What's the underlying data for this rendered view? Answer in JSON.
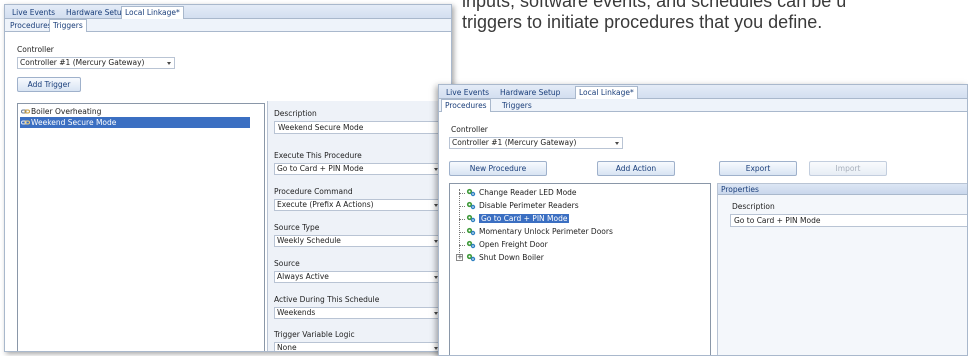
{
  "caption": {
    "line1": "inputs, software events, and schedules can be u",
    "line2": "triggers to initiate procedures that you define."
  },
  "window1": {
    "main_tabs": [
      "Live Events",
      "Hardware Setup",
      "Local Linkage*"
    ],
    "sub_tabs": [
      "Procedures",
      "Triggers"
    ],
    "controller_label": "Controller",
    "controller_value": "Controller #1 (Mercury Gateway)",
    "add_trigger_label": "Add Trigger",
    "triggers": [
      "Boiler Overheating",
      "Weekend Secure Mode"
    ],
    "selected_trigger": 1,
    "properties": [
      {
        "label": "Description",
        "value": "Weekend Secure Mode",
        "type": "text"
      },
      {
        "label": "Execute This Procedure",
        "value": "Go to Card + PIN Mode",
        "type": "combo"
      },
      {
        "label": "Procedure Command",
        "value": "Execute (Prefix A Actions)",
        "type": "combo"
      },
      {
        "label": "Source Type",
        "value": "Weekly Schedule",
        "type": "combo"
      },
      {
        "label": "Source",
        "value": "Always Active",
        "type": "combo"
      },
      {
        "label": "Active During This Schedule",
        "value": "Weekends",
        "type": "combo"
      },
      {
        "label": "Trigger Variable Logic",
        "value": "None",
        "type": "combo"
      }
    ]
  },
  "window2": {
    "main_tabs": [
      "Live Events",
      "Hardware Setup",
      "Local Linkage*"
    ],
    "sub_tabs": [
      "Procedures",
      "Triggers"
    ],
    "controller_label": "Controller",
    "controller_value": "Controller #1 (Mercury Gateway)",
    "new_procedure_label": "New Procedure",
    "add_action_label": "Add Action",
    "export_label": "Export",
    "import_label": "Import",
    "procedures": [
      "Change Reader LED Mode",
      "Disable Perimeter Readers",
      "Go to Card + PIN Mode",
      "Momentary Unlock Perimeter Doors",
      "Open Freight Door",
      "Shut Down Boiler"
    ],
    "selected_procedure": 2,
    "properties_header": "Properties",
    "description_label": "Description",
    "description_value": "Go to Card + PIN Mode"
  },
  "colors": {
    "accent": "#3b6fc2",
    "tab_text": "#1a3e7a",
    "border": "#a9b8cc"
  }
}
